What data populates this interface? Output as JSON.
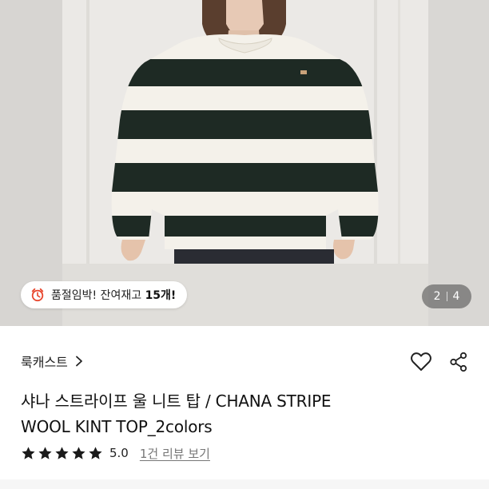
{
  "stock_badge": {
    "prefix": "품절임박! 잔여재고 ",
    "count": "15개!"
  },
  "pager": {
    "current": "2",
    "total": "4"
  },
  "brand": {
    "name": "룩캐스트"
  },
  "product": {
    "title_line1": "샤나 스트라이프 울 니트 탑 / CHANA STRIPE",
    "title_line2": "WOOL KINT TOP_2colors"
  },
  "rating": {
    "stars": 5,
    "score": "5.0",
    "review_link": "1건 리뷰 보기"
  },
  "colors": {
    "stripe_dark": "#1e2a24",
    "stripe_light": "#f4f1ea",
    "clock_red": "#e8452c"
  }
}
